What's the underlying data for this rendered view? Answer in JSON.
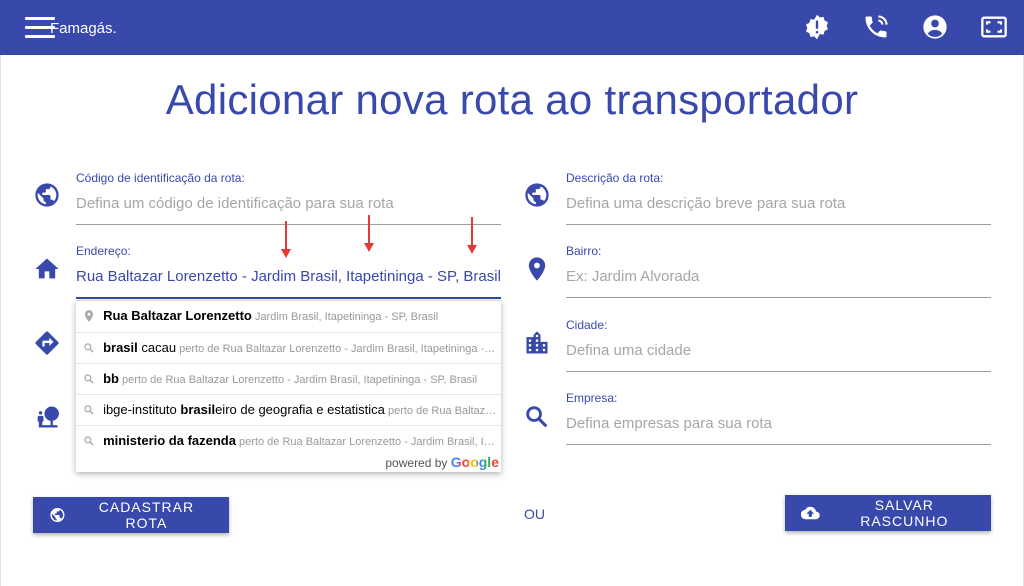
{
  "app": {
    "brand": "Famagás."
  },
  "header_icons": [
    "report-icon",
    "phone-in-talk-icon",
    "account-circle-icon",
    "fullscreen-icon"
  ],
  "colors": {
    "primary": "#3949ab",
    "arrow": "#e53935"
  },
  "page": {
    "title": "Adicionar nova rota ao transportador"
  },
  "form": {
    "route_code": {
      "label": "Código de identificação da rota:",
      "placeholder": "Defina um código de identificação para sua rota"
    },
    "address": {
      "label": "Endereço:",
      "value": "Rua Baltazar Lorenzetto - Jardim Brasil, Itapetininga - SP, Brasil"
    },
    "description": {
      "label": "Descrição da rota:",
      "placeholder": "Defina uma descrição breve para sua rota"
    },
    "neighborhood": {
      "label": "Bairro:",
      "placeholder": "Ex: Jardim Alvorada"
    },
    "city": {
      "label": "Cidade:",
      "placeholder": "Defina uma cidade"
    },
    "company": {
      "label": "Empresa:",
      "placeholder": "Defina empresas para sua rota"
    }
  },
  "autocomplete": {
    "items": [
      {
        "main": "Rua Baltazar Lorenzetto",
        "context": "Jardim Brasil, Itapetininga - SP, Brasil"
      },
      {
        "main_bold": "brasil",
        "main_rest": " cacau",
        "near": "perto de",
        "context": "Rua Baltazar Lorenzetto - Jardim Brasil, Itapetininga - SP, Brasil"
      },
      {
        "main_bold": "bb",
        "near": "perto de",
        "context": "Rua Baltazar Lorenzetto - Jardim Brasil, Itapetininga - SP, Brasil"
      },
      {
        "main_pre": "ibge-instituto ",
        "main_bold": "brasil",
        "main_rest": "eiro de geografia e estatistica",
        "near": "perto de",
        "context": "Rua Baltazar Lorenzetto - Jardim Brasil, Itapetininga - SP, Brasil"
      },
      {
        "main_bold": "ministerio da fazenda",
        "near": "perto de",
        "context": "Rua Baltazar Lorenzetto - Jardim Brasil, Itapetininga - SP, Brasil"
      }
    ],
    "powered_by": "powered by",
    "google": "Google"
  },
  "actions": {
    "register": "CADASTRAR ROTA",
    "or": "OU",
    "save_draft": "SALVAR RASCUNHO"
  }
}
